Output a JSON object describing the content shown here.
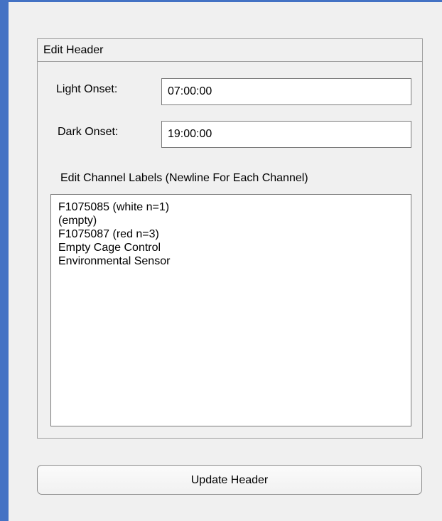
{
  "panel": {
    "title": "Edit Header"
  },
  "fields": {
    "light_onset": {
      "label": "Light Onset:",
      "value": "07:00:00"
    },
    "dark_onset": {
      "label": "Dark Onset:",
      "value": "19:00:00"
    }
  },
  "channels": {
    "label": "Edit Channel Labels (Newline For Each Channel)",
    "lines": [
      "F1075085 (white n=1)",
      "(empty)",
      "F1075087 (red n=3)",
      "Empty Cage Control",
      "Environmental Sensor"
    ]
  },
  "update_button": {
    "label": "Update Header"
  },
  "colors": {
    "accent": "#4472c4",
    "window_background": "#f0f0f0",
    "border": "#a0a0a0"
  }
}
